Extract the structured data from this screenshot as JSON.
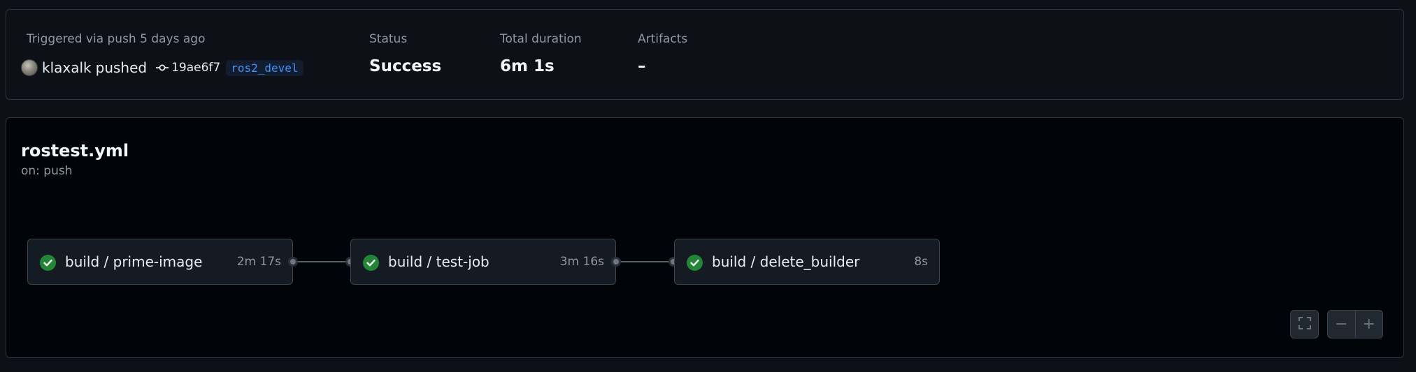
{
  "summary": {
    "trigger_label": "Triggered via push 5 days ago",
    "actor": "klaxalk",
    "action": "pushed",
    "commit_sha": "19ae6f7",
    "branch": "ros2_devel",
    "status_label": "Status",
    "status_value": "Success",
    "duration_label": "Total duration",
    "duration_value": "6m 1s",
    "artifacts_label": "Artifacts",
    "artifacts_value": "–"
  },
  "workflow": {
    "file": "rostest.yml",
    "trigger": "on: push",
    "jobs": [
      {
        "name": "build / prime-image",
        "duration": "2m 17s",
        "status": "success"
      },
      {
        "name": "build / test-job",
        "duration": "3m 16s",
        "status": "success"
      },
      {
        "name": "build / delete_builder",
        "duration": "8s",
        "status": "success"
      }
    ]
  },
  "controls": {
    "fullscreen_icon": "fullscreen-icon",
    "zoom_out_label": "−",
    "zoom_in_label": "+"
  },
  "colors": {
    "success": "#238636",
    "branch_text": "#4493f8"
  }
}
